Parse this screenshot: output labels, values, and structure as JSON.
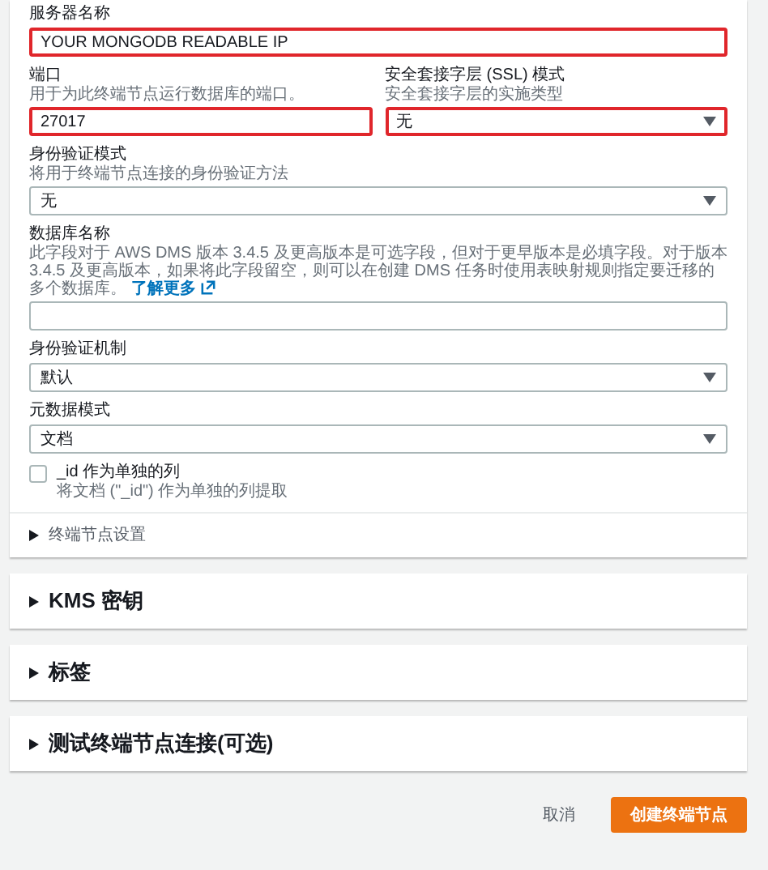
{
  "fields": [
    {
      "kind": "input",
      "label": "服务器名称",
      "value": "YOUR MONGODB READABLE IP",
      "highlighted": true
    },
    {
      "kind": "pair",
      "items": [
        {
          "kind": "input",
          "label": "端口",
          "description": "用于为此终端节点运行数据库的端口。",
          "value": "27017",
          "highlighted": true
        },
        {
          "kind": "select",
          "label": "安全套接字层 (SSL) 模式",
          "description": "安全套接字层的实施类型",
          "value": "无",
          "highlighted": true
        }
      ]
    },
    {
      "kind": "select",
      "label": "身份验证模式",
      "description": "将用于终端节点连接的身份验证方法",
      "value": "无",
      "highlighted": false
    },
    {
      "kind": "input",
      "label": "数据库名称",
      "description": "此字段对于 AWS DMS 版本 3.4.5 及更高版本是可选字段，但对于更早版本是必填字段。对于版本 3.4.5 及更高版本，如果将此字段留空，则可以在创建 DMS 任务时使用表映射规则指定要迁移的多个数据库。",
      "link": "了解更多",
      "highlighted": false
    },
    {
      "kind": "select",
      "label": "身份验证机制",
      "value": "默认",
      "highlighted": false
    },
    {
      "kind": "select",
      "label": "元数据模式",
      "value": "文档",
      "highlighted": false
    },
    {
      "kind": "checkbox",
      "label": "_id 作为单独的列",
      "description": "将文档 (\"_id\") 作为单独的列提取",
      "checked": false
    }
  ],
  "inner_section": {
    "title": "终端节点设置",
    "expanded": false
  },
  "sections": [
    {
      "title": "KMS 密钥",
      "expanded": false
    },
    {
      "title": "标签",
      "expanded": false
    },
    {
      "title": "测试终端节点连接(可选)",
      "expanded": false
    }
  ],
  "buttons": [
    {
      "label": "取消",
      "kind": "link"
    },
    {
      "label": "创建终端节点",
      "kind": "primary"
    }
  ]
}
